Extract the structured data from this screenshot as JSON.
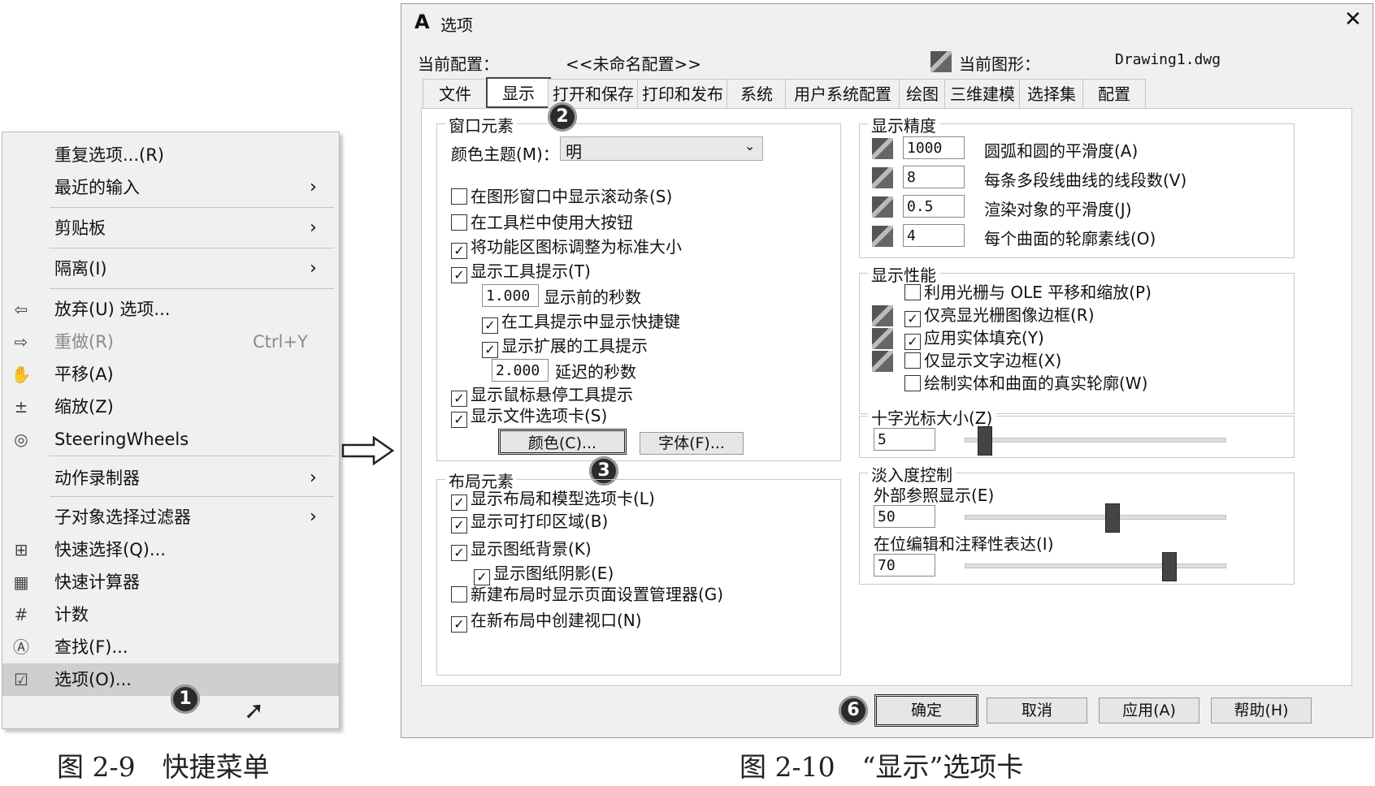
{
  "menu": {
    "items": [
      {
        "label": "重复选项...(R)",
        "icon": ""
      },
      {
        "label": "最近的输入",
        "submenu": true,
        "icon": ""
      },
      {
        "label": "剪贴板",
        "submenu": true,
        "icon": ""
      },
      {
        "label": "隔离(I)",
        "submenu": true,
        "icon": ""
      },
      {
        "label": "放弃(U) 选项...",
        "icon": "undo-icon",
        "glyph": "⇦"
      },
      {
        "label": "重做(R)",
        "shortcut": "Ctrl+Y",
        "disabled": true,
        "icon": "redo-icon",
        "glyph": "⇨"
      },
      {
        "label": "平移(A)",
        "icon": "pan-hand-icon",
        "glyph": "✋"
      },
      {
        "label": "缩放(Z)",
        "icon": "zoom-icon",
        "glyph": "±"
      },
      {
        "label": "SteeringWheels",
        "icon": "steering-wheel-icon",
        "glyph": "◎"
      },
      {
        "label": "动作录制器",
        "submenu": true,
        "icon": ""
      },
      {
        "label": "子对象选择过滤器",
        "submenu": true,
        "icon": ""
      },
      {
        "label": "快速选择(Q)...",
        "icon": "quick-select-icon",
        "glyph": "⊞"
      },
      {
        "label": "快速计算器",
        "icon": "calculator-icon",
        "glyph": "▦"
      },
      {
        "label": "计数",
        "icon": "count-icon",
        "glyph": "#"
      },
      {
        "label": "查找(F)...",
        "icon": "find-icon",
        "glyph": "Ⓐ"
      },
      {
        "label": "选项(O)...",
        "icon": "options-icon",
        "glyph": "☑",
        "highlighted": true
      }
    ],
    "callout": "1"
  },
  "caption_left": "图 2-9　快捷菜单",
  "caption_right": "图 2-10　“显示”选项卡",
  "dialog": {
    "title": "选项",
    "profile_label": "当前配置：",
    "profile_value": "<<未命名配置>>",
    "drawing_label": "当前图形：",
    "drawing_value": "Drawing1.dwg",
    "tabs": [
      "文件",
      "显示",
      "打开和保存",
      "打印和发布",
      "系统",
      "用户系统配置",
      "绘图",
      "三维建模",
      "选择集",
      "配置"
    ],
    "active_tab": "显示",
    "window_elements": {
      "title": "窗口元素",
      "color_scheme_label": "颜色主题(M)：",
      "color_scheme_value": "明",
      "checks": [
        {
          "label": "在图形窗口中显示滚动条(S)",
          "checked": false
        },
        {
          "label": "在工具栏中使用大按钮",
          "checked": false
        },
        {
          "label": "将功能区图标调整为标准大小",
          "checked": true
        },
        {
          "label": "显示工具提示(T)",
          "checked": true
        }
      ],
      "seconds_value": "1.000",
      "seconds_label": "显示前的秒数",
      "show_shortcut": "在工具提示中显示快捷键",
      "show_extended": "显示扩展的工具提示",
      "delay_value": "2.000",
      "delay_label": "延迟的秒数",
      "hover_tooltip": "显示鼠标悬停工具提示",
      "file_tabs": "显示文件选项卡(S)",
      "colors_button": "颜色(C)...",
      "fonts_button": "字体(F)...",
      "callout_a": "2",
      "callout_b": "3"
    },
    "layout_elements": {
      "title": "布局元素",
      "checks": [
        {
          "label": "显示布局和模型选项卡(L)",
          "checked": true
        },
        {
          "label": "显示可打印区域(B)",
          "checked": true
        },
        {
          "label": "显示图纸背景(K)",
          "checked": true
        },
        {
          "label": "显示图纸阴影(E)",
          "checked": true
        },
        {
          "label": "新建布局时显示页面设置管理器(G)",
          "checked": false
        },
        {
          "label": "在新布局中创建视口(N)",
          "checked": true
        }
      ]
    },
    "resolution": {
      "title": "显示精度",
      "rows": [
        {
          "value": "1000",
          "label": "圆弧和圆的平滑度(A)"
        },
        {
          "value": "8",
          "label": "每条多段线曲线的线段数(V)"
        },
        {
          "value": "0.5",
          "label": "渲染对象的平滑度(J)"
        },
        {
          "value": "4",
          "label": "每个曲面的轮廓素线(O)"
        }
      ]
    },
    "performance": {
      "title": "显示性能",
      "checks": [
        {
          "label": "利用光栅与 OLE 平移和缩放(P)",
          "checked": false
        },
        {
          "label": "仅亮显光栅图像边框(R)",
          "checked": true
        },
        {
          "label": "应用实体填充(Y)",
          "checked": true
        },
        {
          "label": "仅显示文字边框(X)",
          "checked": false
        },
        {
          "label": "绘制实体和曲面的真实轮廓(W)",
          "checked": false
        }
      ]
    },
    "crosshair": {
      "title": "十字光标大小(Z)",
      "value": "5",
      "level": 5
    },
    "fade": {
      "title": "淡入度控制",
      "xref_label": "外部参照显示(E)",
      "xref_value": "50",
      "xref_level": 50,
      "inplace_label": "在位编辑和注释性表达(I)",
      "inplace_value": "70",
      "inplace_level": 70
    },
    "buttons": {
      "ok": "确定",
      "cancel": "取消",
      "apply": "应用(A)",
      "help": "帮助(H)",
      "callout": "6"
    }
  }
}
